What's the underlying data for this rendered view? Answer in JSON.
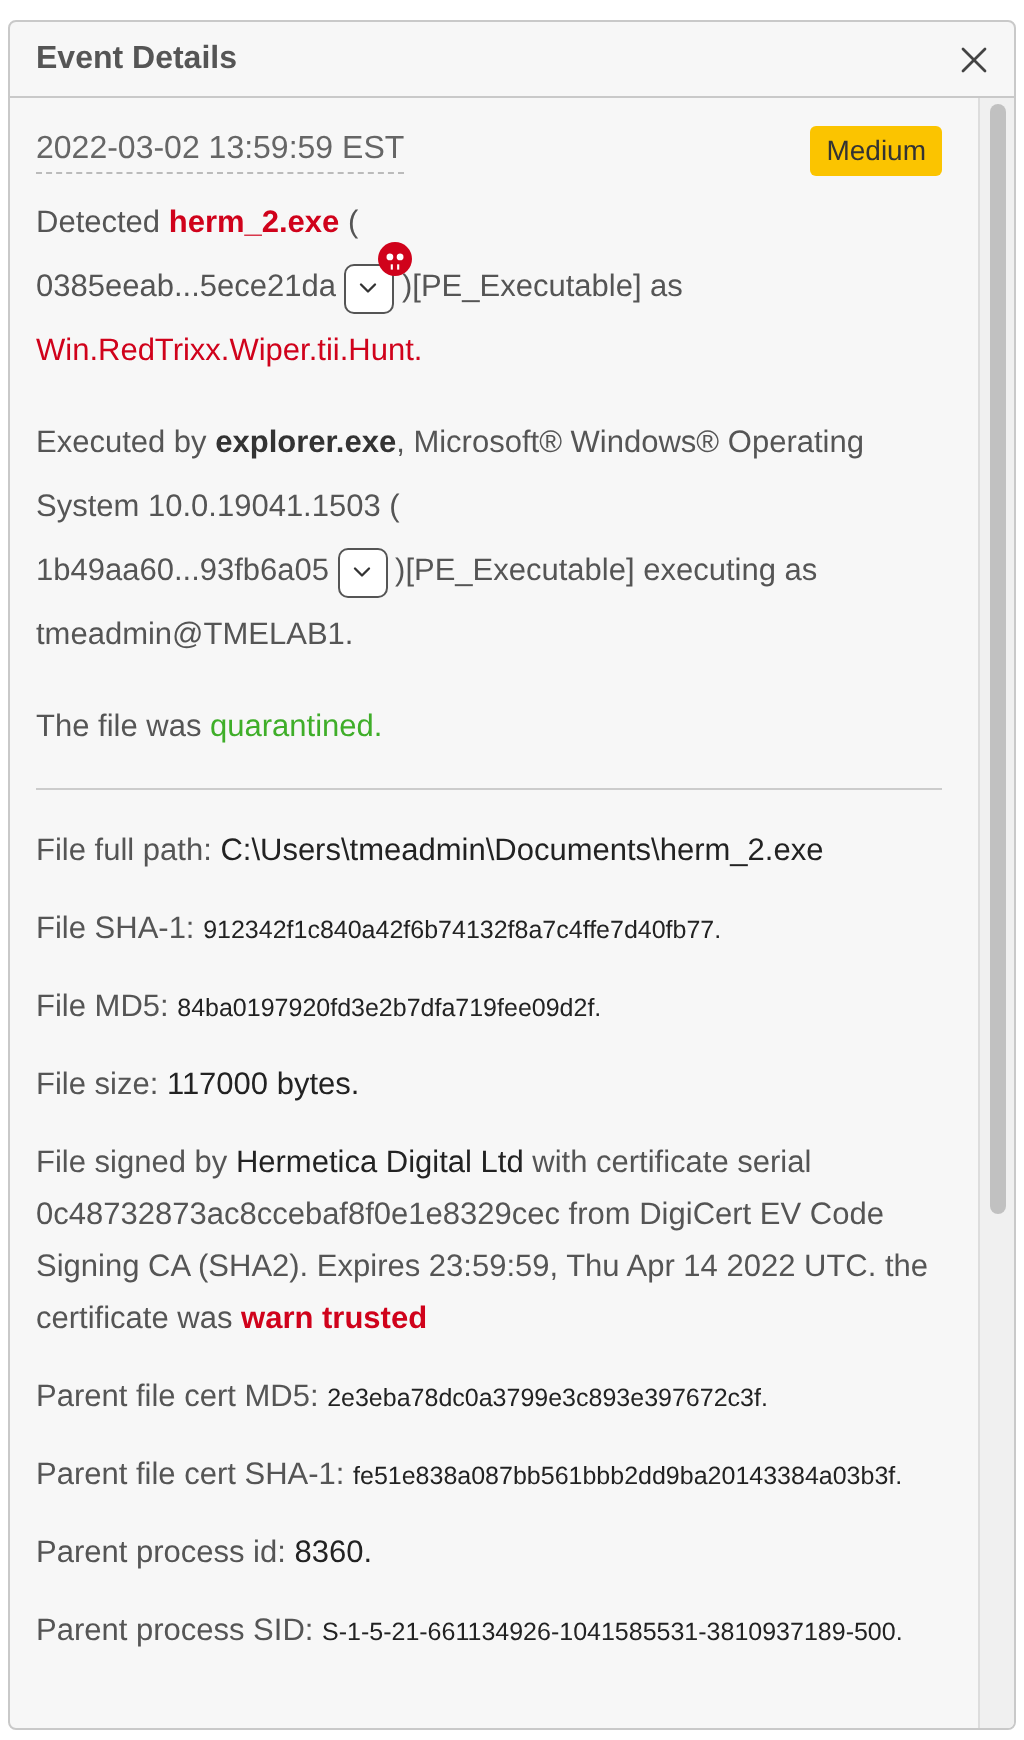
{
  "panel": {
    "title": "Event Details"
  },
  "event": {
    "timestamp": "2022-03-02 13:59:59 EST",
    "severity": "Medium"
  },
  "summary": [
    {
      "kind": "hash",
      "lead": [
        {
          "text": "Detected ",
          "kind": "text"
        },
        {
          "text": "herm_2.exe",
          "kind": "alert"
        },
        {
          "text": " (",
          "kind": "text"
        }
      ],
      "hash": "0385eeab...5ece21da",
      "flagged": true,
      "after": [
        {
          "text": ")[PE_Executable] as",
          "kind": "text"
        }
      ],
      "next": [
        {
          "text": "Win.RedTrixx.Wiper.tii.Hunt.",
          "kind": "threat"
        }
      ]
    },
    {
      "kind": "hash",
      "lead": [
        {
          "text": "Executed by ",
          "kind": "text"
        },
        {
          "text": "explorer.exe",
          "kind": "process"
        },
        {
          "text": ", Microsoft® Windows® Operating System 10.0.19041.1503 (",
          "kind": "text"
        }
      ],
      "hash": "1b49aa60...93fb6a05",
      "flagged": false,
      "after": [
        {
          "text": ")[PE_Executable] executing as",
          "kind": "text"
        }
      ],
      "next": [
        {
          "text": "tmeadmin@TMELAB1.",
          "kind": "text"
        }
      ]
    },
    {
      "kind": "text",
      "parts": [
        {
          "text": "The file was ",
          "kind": "text"
        },
        {
          "text": "quarantined.",
          "kind": "status"
        }
      ]
    }
  ],
  "details": [
    [
      {
        "text": "File full path: ",
        "kind": "text"
      },
      {
        "text": "C:\\Users\\tmeadmin\\Documents\\herm_2.exe",
        "kind": "value"
      }
    ],
    [
      {
        "text": "File SHA-1: ",
        "kind": "text"
      },
      {
        "text": "912342f1c840a42f6b74132f8a7c4ffe7d40fb77.",
        "kind": "digest"
      }
    ],
    [
      {
        "text": "File MD5: ",
        "kind": "text"
      },
      {
        "text": "84ba0197920fd3e2b7dfa719fee09d2f.",
        "kind": "digest"
      }
    ],
    [
      {
        "text": "File size: ",
        "kind": "text"
      },
      {
        "text": "117000 bytes.",
        "kind": "value"
      }
    ],
    [
      {
        "text": "File signed by ",
        "kind": "text"
      },
      {
        "text": "Hermetica Digital Ltd",
        "kind": "value"
      },
      {
        "text": " with certificate serial 0c48732873ac8ccebaf8f0e1e8329cec from DigiCert EV Code Signing CA (SHA2). Expires 23:59:59, Thu Apr 14 2022 UTC. the certificate was ",
        "kind": "text"
      },
      {
        "text": "warn trusted",
        "kind": "alert"
      }
    ],
    [
      {
        "text": "Parent file cert MD5: ",
        "kind": "text"
      },
      {
        "text": "2e3eba78dc0a3799e3c893e397672c3f.",
        "kind": "digest"
      }
    ],
    [
      {
        "text": "Parent file cert SHA-1: ",
        "kind": "text"
      },
      {
        "text": "fe51e838a087bb561bbb2dd9ba20143384a03b3f.",
        "kind": "digest"
      }
    ],
    [
      {
        "text": "Parent process id: ",
        "kind": "text"
      },
      {
        "text": "8360.",
        "kind": "value"
      }
    ],
    [
      {
        "text": "Parent process SID: ",
        "kind": "text"
      },
      {
        "text": "S-1-5-21-661134926-1041585531-3810937189-500.",
        "kind": "digest"
      }
    ]
  ]
}
